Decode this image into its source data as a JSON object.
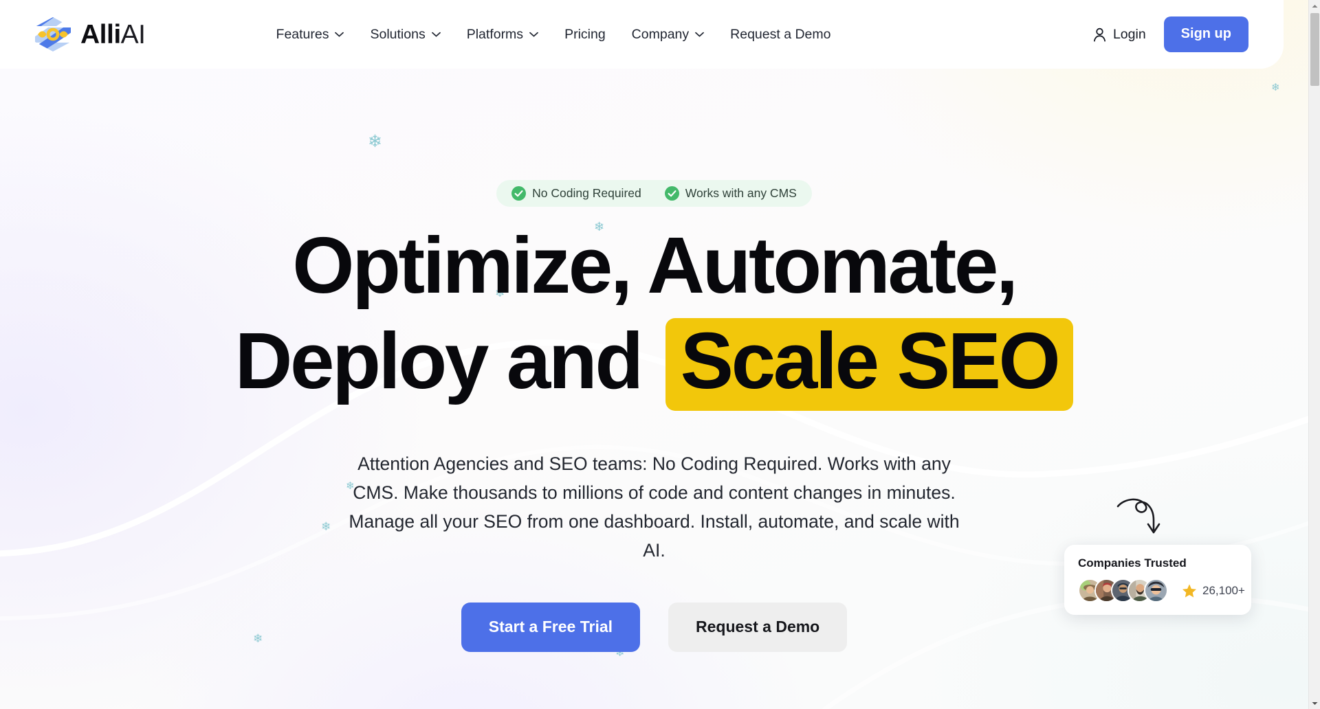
{
  "brand": {
    "name_bold": "Alli",
    "name_light": "AI",
    "logo_icon": "hexagon-logo-icon",
    "accent_blue": "#4d70e8",
    "accent_yellow": "#f2c70b",
    "accent_green": "#43b96a",
    "snowflake_color": "#8cc9d2"
  },
  "header": {
    "nav_items": [
      {
        "label": "Features",
        "has_dropdown": true,
        "icon": "chevron-down-icon"
      },
      {
        "label": "Solutions",
        "has_dropdown": true,
        "icon": "chevron-down-icon"
      },
      {
        "label": "Platforms",
        "has_dropdown": true,
        "icon": "chevron-down-icon"
      },
      {
        "label": "Pricing",
        "has_dropdown": false,
        "icon": ""
      },
      {
        "label": "Company",
        "has_dropdown": true,
        "icon": "chevron-down-icon"
      },
      {
        "label": "Request a Demo",
        "has_dropdown": false,
        "icon": ""
      }
    ],
    "login_label": "Login",
    "login_icon": "user-icon",
    "signup_label": "Sign up"
  },
  "hero": {
    "badges": [
      {
        "label": "No Coding Required",
        "icon": "check-circle-icon"
      },
      {
        "label": "Works with any CMS",
        "icon": "check-circle-icon"
      }
    ],
    "headline_line1": "Optimize, Automate,",
    "headline_line2_prefix": "Deploy and ",
    "headline_highlight": "Scale SEO",
    "subheadline": "Attention Agencies and SEO teams: No Coding Required. Works with any CMS. Make thousands to millions of code and content changes in minutes. Manage all your SEO from one dashboard. Install, automate, and scale with AI.",
    "primary_cta": "Start a Free Trial",
    "secondary_cta": "Request a Demo"
  },
  "trust_card": {
    "title": "Companies Trusted",
    "rating_value": "26,100+",
    "star_icon": "star-icon",
    "avatar_count": 5,
    "arrow_icon": "curved-arrow-icon"
  },
  "scrollbar": {
    "up_icon": "scroll-up-arrow-icon",
    "down_icon": "scroll-down-arrow-icon"
  }
}
